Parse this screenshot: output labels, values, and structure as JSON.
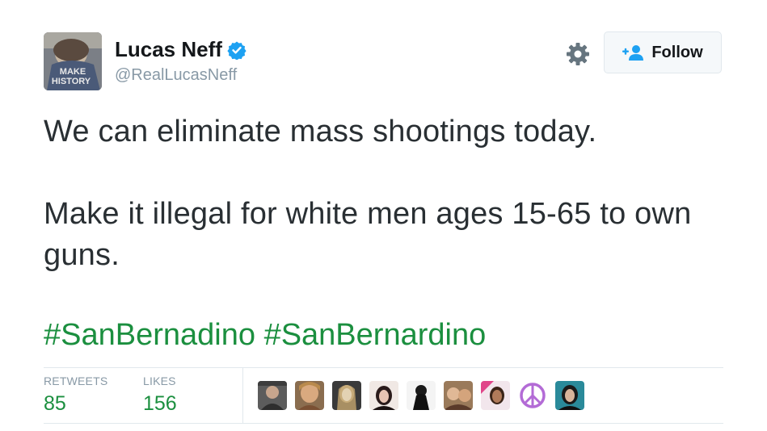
{
  "author": {
    "name": "Lucas Neff",
    "handle": "@RealLucasNeff",
    "avatar_text_line1": "MAKE",
    "avatar_text_line2": "HISTORY"
  },
  "actions": {
    "follow_label": "Follow"
  },
  "tweet": {
    "paragraph1": "We can eliminate mass shootings today.",
    "paragraph2": "Make it illegal for white men ages 15-65 to own guns.",
    "hashtag1": "#SanBernadino",
    "hashtag2": "#SanBernardino"
  },
  "stats": {
    "retweets_label": "RETWEETS",
    "retweets_value": "85",
    "likes_label": "LIKES",
    "likes_value": "156"
  },
  "colors": {
    "accent_green": "#1b8f3f",
    "verified_blue": "#1da1f2",
    "muted": "#8899a6"
  },
  "icons": {
    "verified": "verified-badge-icon",
    "settings": "gear-icon",
    "follow": "add-user-icon"
  }
}
